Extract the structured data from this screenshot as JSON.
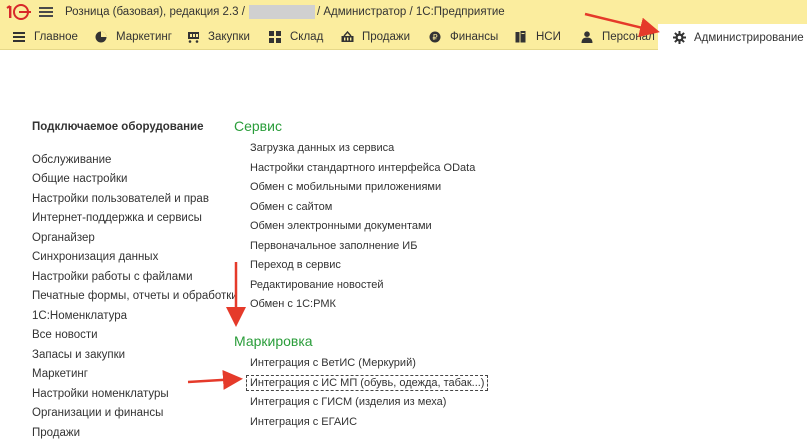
{
  "titlebar": {
    "app_title": "Розница (базовая), редакция 2.3 /",
    "user_suffix": "/ Администратор / 1С:Предприятие"
  },
  "sections": [
    {
      "label": "Главное",
      "icon": "hamburger-icon"
    },
    {
      "label": "Маркетинг",
      "icon": "pie-chart-icon"
    },
    {
      "label": "Закупки",
      "icon": "cart-icon"
    },
    {
      "label": "Склад",
      "icon": "warehouse-grid-icon"
    },
    {
      "label": "Продажи",
      "icon": "basket-icon"
    },
    {
      "label": "Финансы",
      "icon": "ruble-coin-icon"
    },
    {
      "label": "НСИ",
      "icon": "books-icon"
    },
    {
      "label": "Персонал",
      "icon": "person-icon"
    },
    {
      "label": "Администрирование",
      "icon": "gear-icon"
    }
  ],
  "left_panel": {
    "title": "Подключаемое оборудование",
    "items": [
      "Обслуживание",
      "Общие настройки",
      "Настройки пользователей и прав",
      "Интернет-поддержка и сервисы",
      "Органайзер",
      "Синхронизация данных",
      "Настройки работы с файлами",
      "Печатные формы, отчеты и обработки",
      "1С:Номенклатура",
      "Все новости",
      "Запасы и закупки",
      "Маркетинг",
      "Настройки номенклатуры",
      "Организации и финансы",
      "Продажи"
    ]
  },
  "service_group": {
    "title": "Сервис",
    "items": [
      "Загрузка данных из сервиса",
      "Настройки стандартного интерфейса OData",
      "Обмен с мобильными приложениями",
      "Обмен с сайтом",
      "Обмен электронными документами",
      "Первоначальное заполнение ИБ",
      "Переход в сервис",
      "Редактирование новостей",
      "Обмен с 1С:РМК"
    ]
  },
  "marking_group": {
    "title": "Маркировка",
    "items": [
      "Интеграция с ВетИС (Меркурий)",
      "Интеграция с ИС МП (обувь, одежда, табак...)",
      "Интеграция с ГИСМ (изделия из меха)",
      "Интеграция с ЕГАИС"
    ]
  },
  "colors": {
    "bar_bg": "#fbed9e",
    "group_head": "#2a9d3a",
    "arrow": "#e53a2a",
    "logo_red": "#d8282a"
  }
}
